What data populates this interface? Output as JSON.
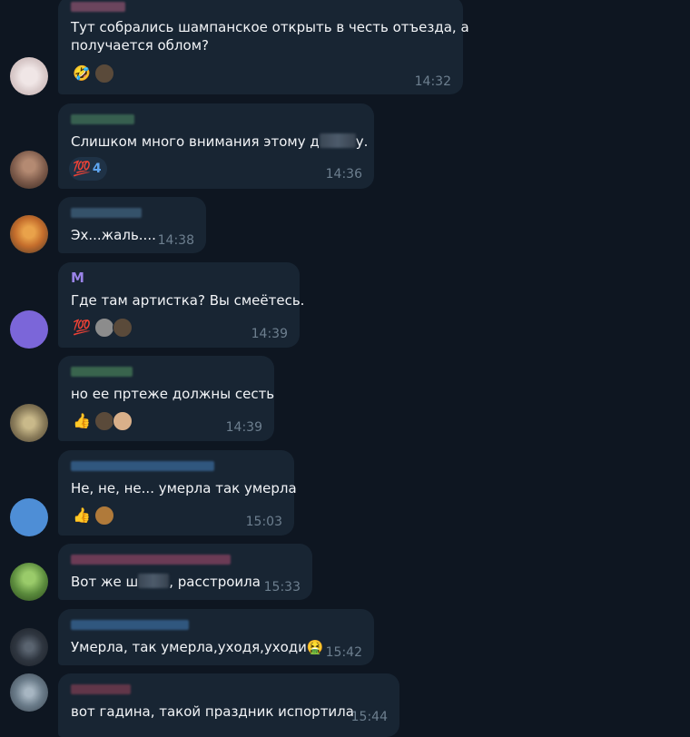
{
  "messages": [
    {
      "id": "m1",
      "sender": "",
      "lines": [
        "Тут собрались шампанское открыть в честь отъезда, а",
        "получается облом?"
      ],
      "time": "14:32",
      "reactions": [
        {
          "emoji": "🤣"
        },
        {
          "emoji": "🐴"
        }
      ],
      "colors": {
        "avatar": "#d8c9c9",
        "sender_blur": "#7a4b65"
      }
    },
    {
      "id": "m2",
      "sender": "",
      "text_before": "Слишком много внимания этому д",
      "text_after": "у.",
      "time": "14:36",
      "reactions": [
        {
          "emoji": "💯",
          "count": "4"
        }
      ],
      "colors": {
        "avatar": "#7c5a4a",
        "sender_blur": "#3d6a55"
      }
    },
    {
      "id": "m3",
      "sender": "",
      "text": "Эх...жаль....",
      "time": "14:38",
      "reactions": [],
      "colors": {
        "avatar": "#c46d2c",
        "sender_blur": "#3b5a74"
      }
    },
    {
      "id": "m4",
      "sender": "M",
      "text": "Где там артистка? Вы смеётесь.",
      "time": "14:39",
      "reactions": [
        {
          "emoji": "💯"
        },
        {
          "emoji": "👤"
        },
        {
          "emoji": "🐴"
        }
      ],
      "colors": {
        "avatar": "#7b66d9",
        "sender_name": "#9a83e8"
      }
    },
    {
      "id": "m5",
      "sender": "",
      "text": "но ее пртеже должны сесть",
      "time": "14:39",
      "reactions": [
        {
          "emoji": "👍"
        },
        {
          "emoji": "🐴"
        },
        {
          "emoji": "👩"
        }
      ],
      "colors": {
        "avatar": "#8a7c5a",
        "sender_blur": "#3f7052"
      }
    },
    {
      "id": "m6",
      "sender": "",
      "text": "Не, не, не... умерла так умерла",
      "time": "15:03",
      "reactions": [
        {
          "emoji": "👍"
        },
        {
          "emoji": "👩"
        }
      ],
      "colors": {
        "avatar": "#4e8ed6",
        "sender_blur": "#35608c"
      }
    },
    {
      "id": "m7",
      "sender": "",
      "text_before": "Вот же ш",
      "text_after": ", расстроила",
      "time": "15:33",
      "reactions": [],
      "colors": {
        "avatar": "#5a8a3c",
        "sender_blur": "#7a3f5c"
      }
    },
    {
      "id": "m8",
      "sender": "",
      "text": "Умерла, так умерла,уходя,уходи🤮",
      "time": "15:42",
      "reactions": [],
      "colors": {
        "avatar": "#2f3640",
        "sender_blur": "#35608c"
      }
    },
    {
      "id": "m9",
      "sender": "",
      "text": "вот гадина, такой праздник испортила",
      "time": "15:44",
      "reactions": [],
      "colors": {
        "avatar": "#6b7c8a",
        "sender_blur": "#6e3a4d"
      }
    }
  ]
}
